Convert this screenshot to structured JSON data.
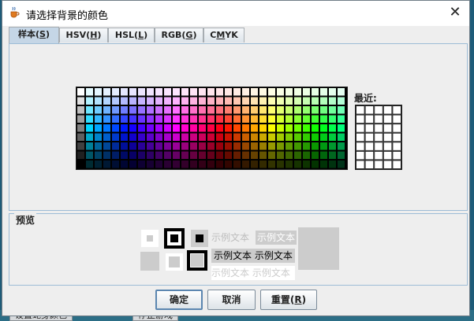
{
  "window": {
    "title": "请选择背景的颜色",
    "close_symbol": "✕"
  },
  "tabs": [
    {
      "label": "样本(",
      "mnemonic": "S",
      "suffix": ")",
      "active": true
    },
    {
      "label": "HSV(",
      "mnemonic": "H",
      "suffix": ")",
      "active": false
    },
    {
      "label": "HSL(",
      "mnemonic": "L",
      "suffix": ")",
      "active": false
    },
    {
      "label": "RGB(",
      "mnemonic": "G",
      "suffix": ")",
      "active": false
    },
    {
      "label": "C",
      "mnemonic": "M",
      "suffix": "YK",
      "active": false
    }
  ],
  "swatches": {
    "recent_label": "最近:"
  },
  "preview": {
    "label": "预览",
    "sample_text": "示例文本",
    "colors": {
      "light_gray": "#cccccc",
      "black": "#000000",
      "white": "#ffffff",
      "highlight": "#cccccc"
    }
  },
  "buttons": {
    "ok_label": "确定",
    "cancel_label": "取消",
    "reset_label": "重置(",
    "reset_mnemonic": "R",
    "reset_suffix": ")"
  },
  "background": {
    "left_button_label": "设置蛇身颜色",
    "right_button_label": "停止游戏"
  }
}
